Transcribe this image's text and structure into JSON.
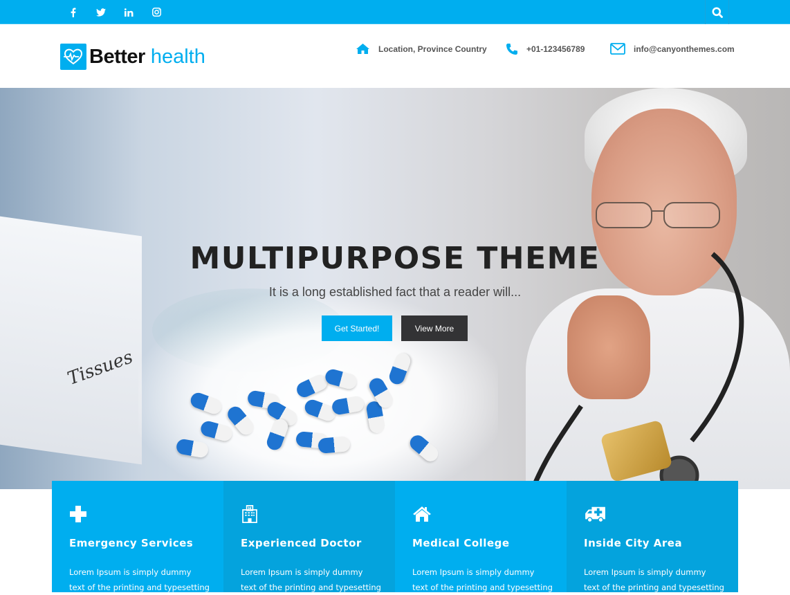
{
  "topbar": {
    "social": [
      {
        "name": "facebook",
        "glyph": "f"
      },
      {
        "name": "twitter",
        "glyph": "t"
      },
      {
        "name": "linkedin",
        "glyph": "in"
      },
      {
        "name": "instagram",
        "glyph": "ig"
      }
    ],
    "search_icon": "search-icon"
  },
  "header": {
    "logo_bold": "Better",
    "logo_light": "health",
    "location": "Location, Province Country",
    "phone": "+01-123456789",
    "email": "info@canyonthemes.com"
  },
  "hero": {
    "title": "MULTIPURPOSE THEME",
    "subtitle": "It is a long established fact that a reader will...",
    "primary_button": "Get Started!",
    "secondary_button": "View More",
    "tissue_label": "Tissues"
  },
  "features": [
    {
      "icon": "plus-icon",
      "title": "Emergency Services",
      "line1": "Lorem Ipsum is simply dummy",
      "line2": "text of the printing and typesetting"
    },
    {
      "icon": "hospital-icon",
      "title": "Experienced Doctor",
      "line1": "Lorem Ipsum is simply dummy",
      "line2": "text of the printing and typesetting"
    },
    {
      "icon": "home-icon",
      "title": "Medical College",
      "line1": "Lorem Ipsum is simply dummy",
      "line2": "text of the printing and typesetting"
    },
    {
      "icon": "ambulance-icon",
      "title": "Inside City Area",
      "line1": "Lorem Ipsum is simply dummy",
      "line2": "text of the printing and typesetting"
    }
  ],
  "colors": {
    "accent": "#00aeef",
    "accent_dark": "#04a3dd",
    "button_dark": "#333335"
  }
}
